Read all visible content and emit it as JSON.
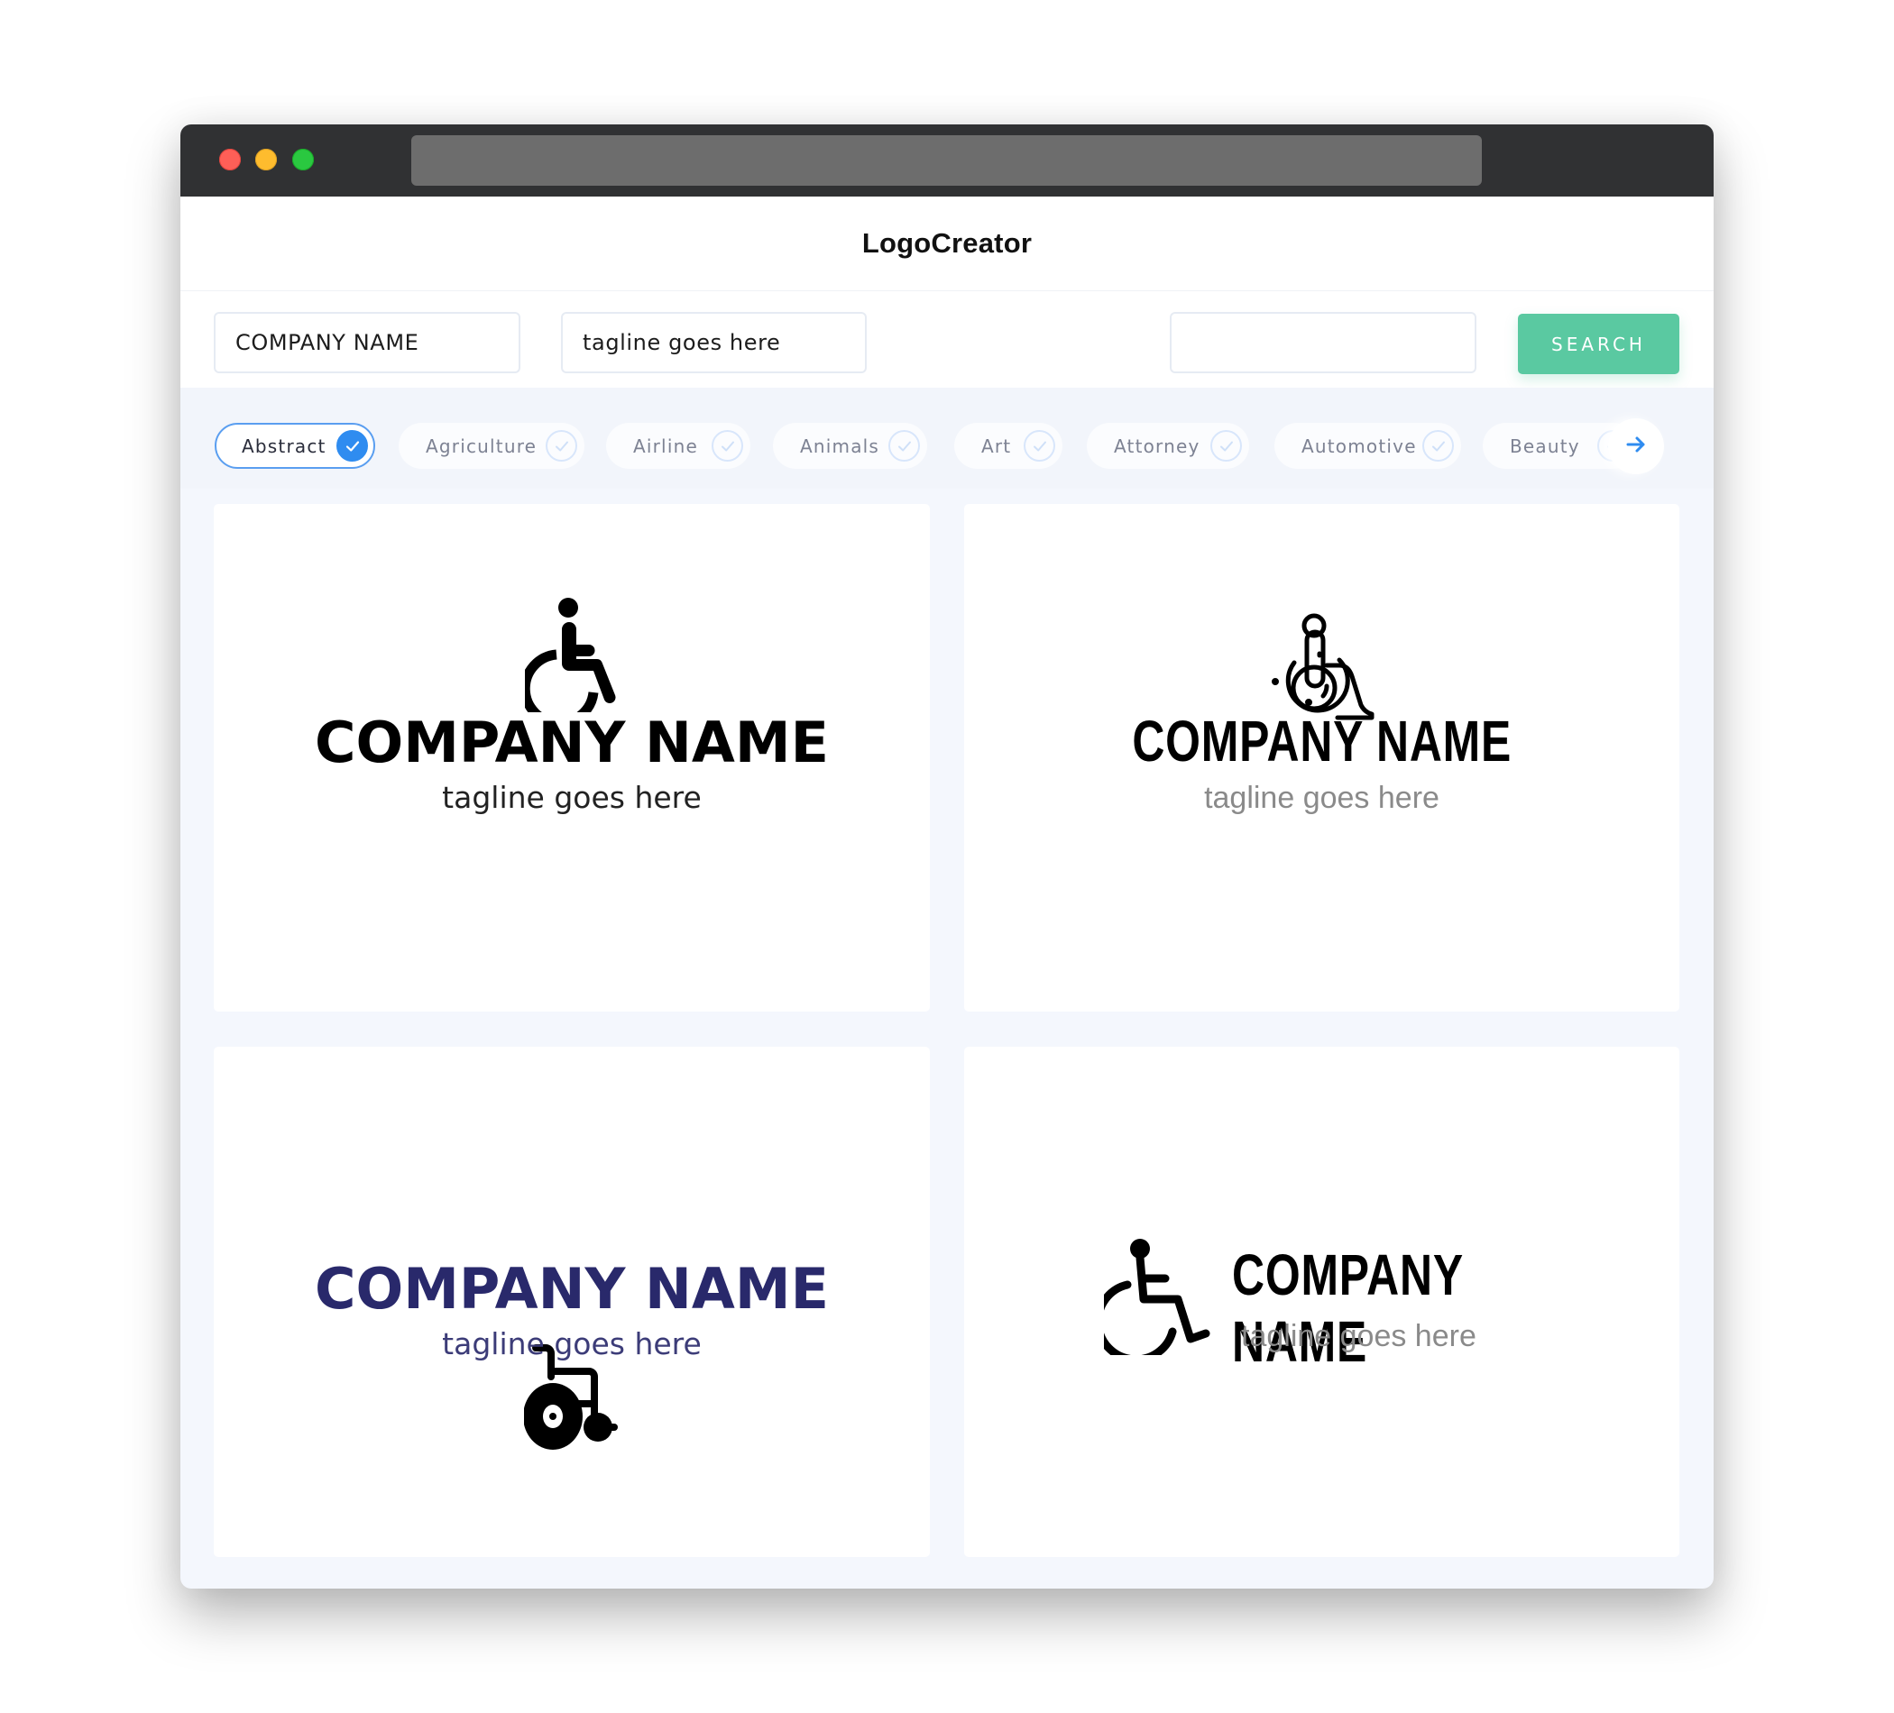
{
  "window": {
    "traffic_lights": [
      "close",
      "minimize",
      "maximize"
    ]
  },
  "header": {
    "title": "LogoCreator"
  },
  "search": {
    "company_name_value": "COMPANY NAME",
    "tagline_value": "tagline goes here",
    "keyword_value": "",
    "button_label": "SEARCH",
    "button_color": "#5ac9a1"
  },
  "categories": {
    "items": [
      {
        "label": "Abstract",
        "selected": true
      },
      {
        "label": "Agriculture",
        "selected": false
      },
      {
        "label": "Airline",
        "selected": false
      },
      {
        "label": "Animals",
        "selected": false
      },
      {
        "label": "Art",
        "selected": false
      },
      {
        "label": "Attorney",
        "selected": false
      },
      {
        "label": "Automotive",
        "selected": false
      },
      {
        "label": "Beauty",
        "selected": false
      }
    ],
    "next_icon": "arrow-right-icon",
    "accent_color": "#2f8cf0"
  },
  "logos": [
    {
      "icon": "wheelchair-filled-icon",
      "company_name": "COMPANY NAME",
      "tagline": "tagline goes here",
      "name_color": "#000000",
      "tagline_color": "#222222"
    },
    {
      "icon": "wheelchair-outline-icon",
      "company_name": "COMPANY NAME",
      "tagline": "tagline goes here",
      "name_color": "#000000",
      "tagline_color": "#8a8a8a"
    },
    {
      "icon": "empty-wheelchair-icon",
      "company_name": "COMPANY NAME",
      "tagline": "tagline goes here",
      "name_color": "#29296b",
      "tagline_color": "#3c3c78"
    },
    {
      "icon": "wheelchair-line-icon",
      "company_name": "COMPANY NAME",
      "tagline": "tagline goes here",
      "name_color": "#000000",
      "tagline_color": "#8a8a8a"
    }
  ]
}
